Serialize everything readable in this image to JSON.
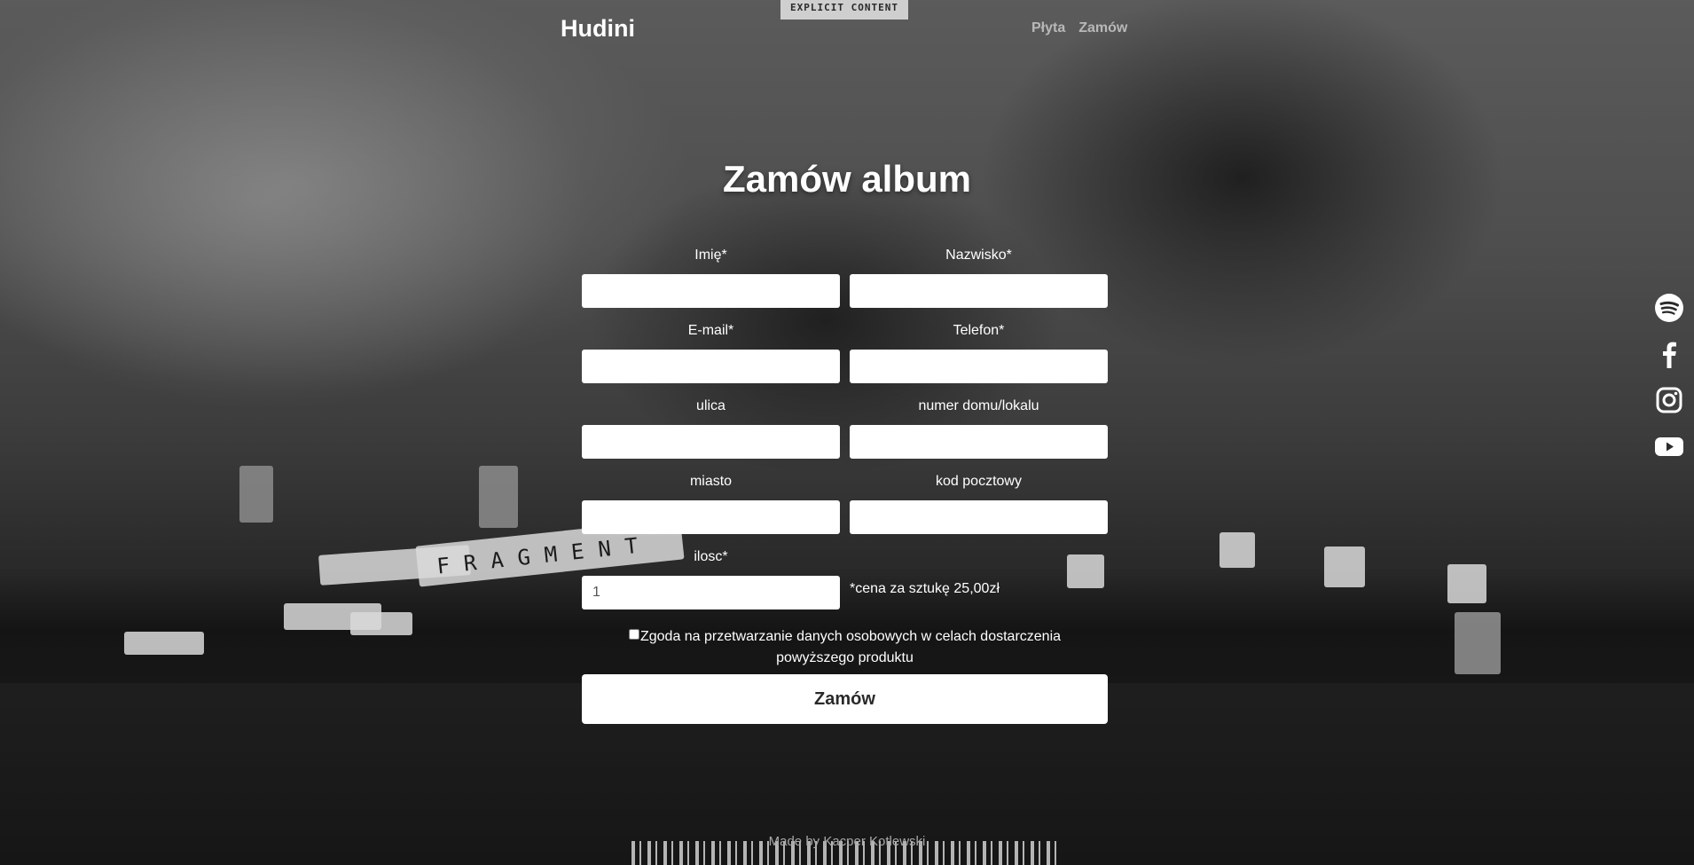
{
  "header": {
    "brand": "Hudini",
    "album_tag": "EXPLICIT CONTENT",
    "nav": [
      {
        "label": "Płyta"
      },
      {
        "label": "Zamów"
      }
    ]
  },
  "scene_text": "FRAGMENT",
  "page": {
    "title": "Zamów album"
  },
  "form": {
    "first_name": {
      "label": "Imię*",
      "value": ""
    },
    "last_name": {
      "label": "Nazwisko*",
      "value": ""
    },
    "email": {
      "label": "E-mail*",
      "value": ""
    },
    "phone": {
      "label": "Telefon*",
      "value": ""
    },
    "street": {
      "label": "ulica",
      "value": ""
    },
    "house_number": {
      "label": "numer domu/lokalu",
      "value": ""
    },
    "city": {
      "label": "miasto",
      "value": ""
    },
    "postal_code": {
      "label": "kod pocztowy",
      "value": ""
    },
    "quantity": {
      "label": "ilosc*",
      "value": "1"
    },
    "price_note": "*cena za sztukę 25,00zł",
    "consent": {
      "label": "Zgoda na przetwarzanie danych osobowych w celach dostarczenia powyższego produktu",
      "checked": false
    },
    "submit_label": "Zamów"
  },
  "footer": {
    "text": "Made by Kacper Kotlewski"
  },
  "social": [
    {
      "icon": "spotify-icon"
    },
    {
      "icon": "facebook-icon"
    },
    {
      "icon": "instagram-icon"
    },
    {
      "icon": "youtube-icon"
    }
  ],
  "colors": {
    "background": "#3c3c3c",
    "text": "#ffffff",
    "nav": "#b8b8b8",
    "footer": "#a8a8a8",
    "button": "#ffffff",
    "button_text": "#2a2a2a"
  }
}
